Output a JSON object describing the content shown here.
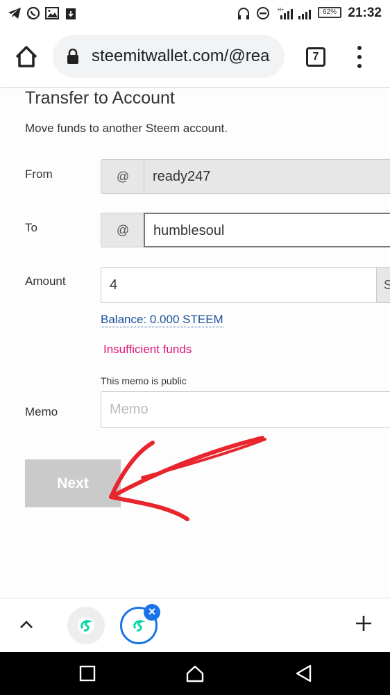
{
  "status_bar": {
    "time": "21:32",
    "battery": "62%",
    "icons": [
      "telegram-icon",
      "whatsapp-icon",
      "gallery-icon",
      "download-icon",
      "headphones-icon",
      "dnd-icon",
      "signal-icon",
      "battery-icon"
    ]
  },
  "browser": {
    "url": "steemitwallet.com/@rea",
    "tab_count": "7"
  },
  "form": {
    "title": "Transfer to Account",
    "subtitle": "Move funds to another Steem account.",
    "from_label": "From",
    "from_prefix": "@",
    "from_value": "ready247",
    "to_label": "To",
    "to_prefix": "@",
    "to_value": "humblesoul",
    "amount_label": "Amount",
    "amount_value": "4",
    "amount_currency": "S",
    "balance_text": "Balance: 0.000 STEEM",
    "error_text": "Insufficient funds",
    "memo_note": "This memo is public",
    "memo_label": "Memo",
    "memo_placeholder": "Memo",
    "next_label": "Next"
  },
  "tab_strip": {
    "close_glyph": "×"
  },
  "colors": {
    "link": "#1a5099",
    "error": "#e0137a",
    "annotation_arrow": "#e8252c",
    "active_tab": "#1a73e8"
  }
}
